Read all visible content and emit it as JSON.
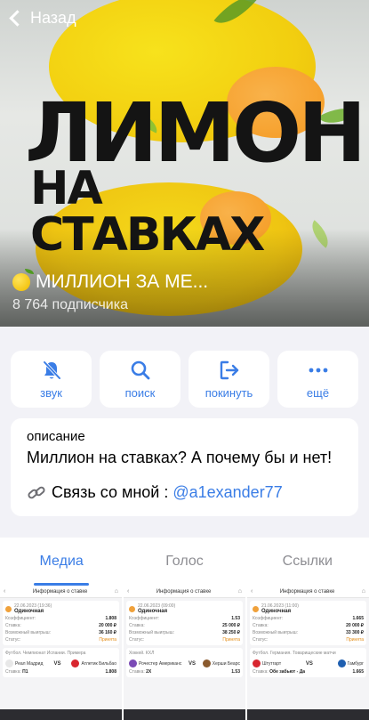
{
  "nav": {
    "back_label": "Назад"
  },
  "cover": {
    "title_line1": "ЛИМОН",
    "title_line2": "НА СТАВКАХ"
  },
  "channel": {
    "name": "МИЛЛИОН ЗА МЕ...",
    "subscribers": "8 764 подписчика"
  },
  "actions": [
    {
      "label": "звук",
      "icon": "bell-slash-icon"
    },
    {
      "label": "поиск",
      "icon": "search-icon"
    },
    {
      "label": "покинуть",
      "icon": "leave-icon"
    },
    {
      "label": "ещё",
      "icon": "more-icon"
    }
  ],
  "description": {
    "caption": "описание",
    "text": "Миллион на ставках? А почему бы и нет!",
    "contact_prefix": "Связь со мной :",
    "contact_link": "@a1exander77"
  },
  "tabs": [
    {
      "label": "Медиа",
      "active": true
    },
    {
      "label": "Голос",
      "active": false
    },
    {
      "label": "Ссылки",
      "active": false
    }
  ],
  "media": [
    {
      "header": "Информация о ставке",
      "date": "22.06.2023 (19:36)",
      "type": "Одиночная",
      "rows": [
        {
          "k": "Коэффициент:",
          "v": "1.808"
        },
        {
          "k": "Ставка:",
          "v": "20 000 ₽"
        },
        {
          "k": "Возможный выигрыш:",
          "v": "36 160 ₽"
        },
        {
          "k": "Статус:",
          "v": "Принята"
        }
      ],
      "league": "Футбол. Чемпионат Испании. Примера",
      "team1": "Реал Мадрид",
      "team2": "Атлетик Бильбао",
      "bet": "П1",
      "odds": "1.808",
      "logo1": "#e8e8e8",
      "logo2": "#d8262f"
    },
    {
      "header": "Информация о ставке",
      "date": "22.06.2023 (09:00)",
      "type": "Одиночная",
      "rows": [
        {
          "k": "Коэффициент:",
          "v": "1.53"
        },
        {
          "k": "Ставка:",
          "v": "25 000 ₽"
        },
        {
          "k": "Возможный выигрыш:",
          "v": "38 250 ₽"
        },
        {
          "k": "Статус:",
          "v": "Принята"
        }
      ],
      "league": "Хоккей. КХЛ",
      "team1": "Рочестер Американс",
      "team2": "Херши Беарс",
      "bet": "2Х",
      "odds": "1.53",
      "logo1": "#7a4ab5",
      "logo2": "#8a5a2e"
    },
    {
      "header": "Информация о ставке",
      "date": "21.06.2023 (11:00)",
      "type": "Одиночная",
      "rows": [
        {
          "k": "Коэффициент:",
          "v": "1.665"
        },
        {
          "k": "Ставка:",
          "v": "20 000 ₽"
        },
        {
          "k": "Возможный выигрыш:",
          "v": "33 300 ₽"
        },
        {
          "k": "Статус:",
          "v": "Принята"
        }
      ],
      "league": "Футбол. Германия. Товарищеские матчи",
      "team1": "Штутгарт",
      "team2": "Гамбург",
      "bet": "Обе забьют - Да",
      "odds": "1.665",
      "logo1": "#d8262f",
      "logo2": "#1f5fb0"
    }
  ],
  "colors": {
    "accent": "#3a7de6",
    "background": "#f2f2f7",
    "card": "#ffffff"
  }
}
